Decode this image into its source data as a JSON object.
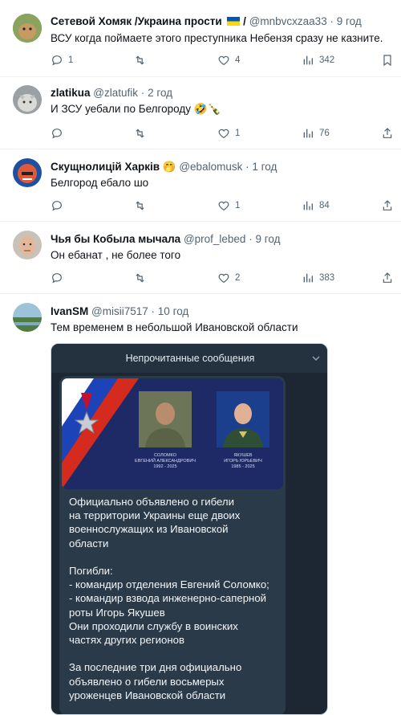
{
  "tweets": [
    {
      "name": "Сетевой Хомяк /Украина прости",
      "name_suffix": "/",
      "handle": "@mnbvcxzaa33",
      "time": "9 год",
      "text": "ВСУ когда поймаете этого преступника Небензя сразу не казните.",
      "replies": "1",
      "retweets": "",
      "likes": "4",
      "views": "342"
    },
    {
      "name": "zlatikua",
      "handle": "@zlatufik",
      "time": "2 год",
      "text": "И ЗСУ уебали по Белгороду 🤣🍾",
      "replies": "",
      "retweets": "",
      "likes": "1",
      "views": "76"
    },
    {
      "name": "Скущнолицій Харків 🤭",
      "handle": "@ebalomusk",
      "time": "1 год",
      "text": "Белгород ебало шо",
      "replies": "",
      "retweets": "",
      "likes": "1",
      "views": "84"
    },
    {
      "name": "Чья бы Кобыла мычала",
      "handle": "@prof_lebed",
      "time": "9 год",
      "text": "Он ебанат , не более того",
      "replies": "",
      "retweets": "",
      "likes": "2",
      "views": "383"
    },
    {
      "name": "IvanSM",
      "handle": "@misii7517",
      "time": "10 год",
      "text": "Тем временем в небольшой Ивановской области"
    }
  ],
  "dot": "·",
  "media": {
    "unread_label": "Непрочитанные сообщения",
    "left_caption": "СОЛОМКО\nЕВГЕНИЙ АЛЕКСАНДРОВИЧ\n1992 - 2025",
    "right_caption": "ЯКУШЕВ\nИГОРЬ ЮРЬЕВИЧ\n1985 - 2025",
    "message": "Официально объявлено о гибели\nна территории Украины еще двоих\nвоеннослужащих из Ивановской\nобласти\n\nПогибли:\n- командир отделения Евгений Соломко;\n- командир взвода инженерно-саперной\nроты Игорь Якушев\nОни проходили службу в воинских\nчастях других регионов\n\nЗа последние три дня официально\nобъявлено о гибели восьмерых\nуроженцев Ивановской области"
  },
  "colors": {
    "text": "#0f1419",
    "muted": "#536471",
    "border": "#eff3f4",
    "flag_blue": "#0057b7",
    "flag_yellow": "#ffd700"
  }
}
